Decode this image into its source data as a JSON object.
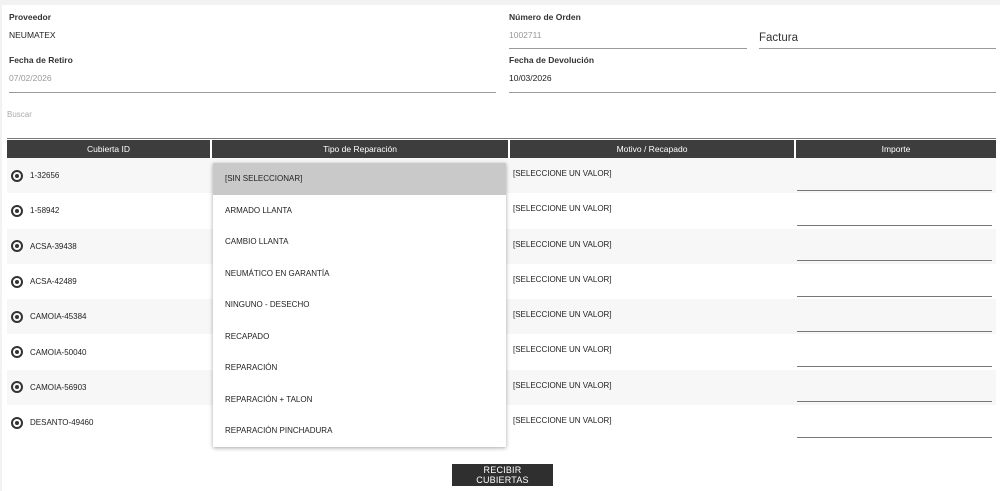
{
  "header": {
    "proveedor_label": "Proveedor",
    "proveedor_value": "NEUMATEX",
    "orden_label": "Número de Orden",
    "orden_value": "1002711",
    "factura_label": "Factura",
    "fecha_retiro_label": "Fecha de Retiro",
    "fecha_retiro_value": "07/02/2026",
    "fecha_devolucion_label": "Fecha de Devolución",
    "fecha_devolucion_value": "10/03/2026"
  },
  "search": {
    "placeholder": "Buscar"
  },
  "table": {
    "columns": [
      "Cubierta ID",
      "Tipo de Reparación",
      "Motivo / Recapado",
      "Importe"
    ],
    "rows": [
      {
        "id": "1-32656",
        "motivo": "[SELECCIONE UN VALOR]"
      },
      {
        "id": "1-58942",
        "motivo": "[SELECCIONE UN VALOR]"
      },
      {
        "id": "ACSA-39438",
        "motivo": "[SELECCIONE UN VALOR]"
      },
      {
        "id": "ACSA-42489",
        "motivo": "[SELECCIONE UN VALOR]"
      },
      {
        "id": "CAMOIA-45384",
        "motivo": "[SELECCIONE UN VALOR]"
      },
      {
        "id": "CAMOIA-50040",
        "motivo": "[SELECCIONE UN VALOR]"
      },
      {
        "id": "CAMOIA-56903",
        "motivo": "[SELECCIONE UN VALOR]"
      },
      {
        "id": "DESANTO-49460",
        "motivo": "[SELECCIONE UN VALOR]"
      }
    ]
  },
  "dropdown": {
    "selected_index": 0,
    "options": [
      "[SIN SELECCIONAR]",
      "ARMADO LLANTA",
      "CAMBIO LLANTA",
      "NEUMÁTICO EN GARANTÍA",
      "NINGUNO - DESECHO",
      "RECAPADO",
      "REPARACIÓN",
      "REPARACIÓN + TALON",
      "REPARACIÓN PINCHADURA"
    ]
  },
  "actions": {
    "submit_label": "RECIBIR CUBIERTAS"
  }
}
